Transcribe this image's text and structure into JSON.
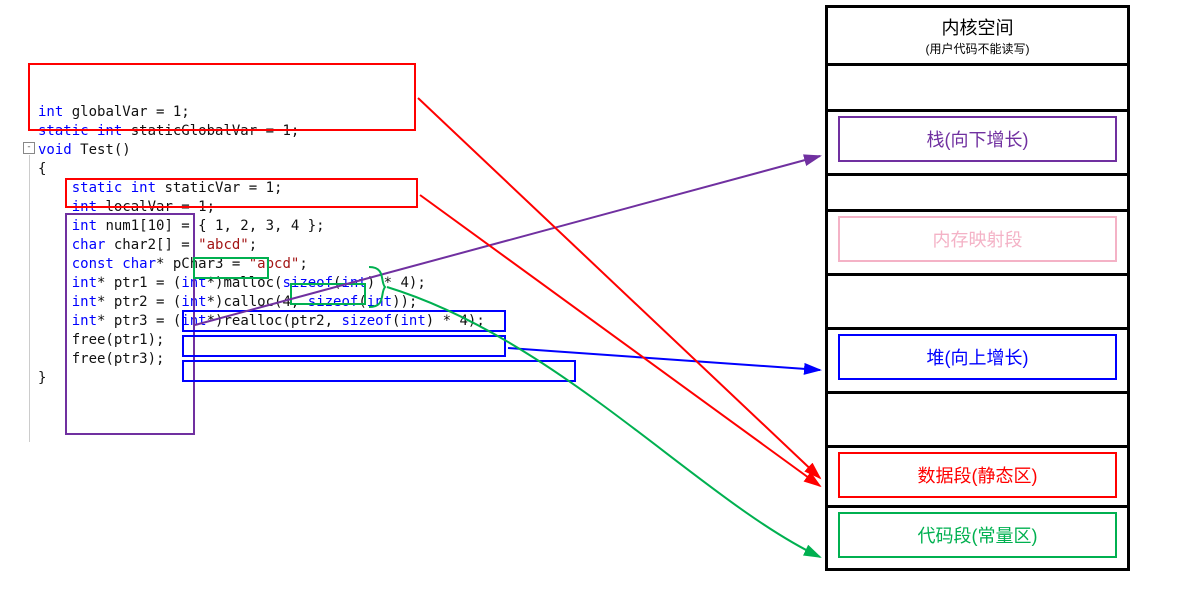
{
  "code": {
    "l1a": "int",
    "l1b": " globalVar = 1;",
    "l2a": "static int",
    "l2b": " staticGlobalVar = 1;",
    "l3a": "void",
    "l3b": " Test()",
    "l4": "{",
    "l5a": "    static int",
    "l5b": " staticVar = 1;",
    "l6a": "    int",
    "l6b": " localVar = 1;",
    "l7a": "    int",
    "l7b": " num1[10] = { 1, 2, 3, 4 };",
    "l8a": "    char",
    "l8b": " char2[] = ",
    "l8c": "\"abcd\"",
    "l8d": ";",
    "l9a": "    const char",
    "l9b": "* pChar3 = ",
    "l9c": "\"abcd\"",
    "l9d": ";",
    "l10a": "    int",
    "l10b": "* ptr1 = (",
    "l10c": "int",
    "l10d": "*)malloc(",
    "l10e": "sizeof",
    "l10f": "(",
    "l10g": "int",
    "l10h": ") * 4);",
    "l11a": "    int",
    "l11b": "* ptr2 = (",
    "l11c": "int",
    "l11d": "*)calloc(4, ",
    "l11e": "sizeof",
    "l11f": "(",
    "l11g": "int",
    "l11h": "));",
    "l12a": "    int",
    "l12b": "* ptr3 = (",
    "l12c": "int",
    "l12d": "*)realloc(ptr2, ",
    "l12e": "sizeof",
    "l12f": "(",
    "l12g": "int",
    "l12h": ") * 4);",
    "l13": "    free(ptr1);",
    "l14": "    free(ptr3);",
    "l15": "}"
  },
  "collapse_glyph": "-",
  "memory": {
    "kernel_title": "内核空间",
    "kernel_sub": "(用户代码不能读写)",
    "stack": "栈(向下增长)",
    "mmap": "内存映射段",
    "heap": "堆(向上增长)",
    "data": "数据段(静态区)",
    "code": "代码段(常量区)"
  },
  "colors": {
    "purple": "#7030a0",
    "pink": "#f4b2c6",
    "blue": "#0000ff",
    "red": "#ff0000",
    "green": "#00b050"
  }
}
